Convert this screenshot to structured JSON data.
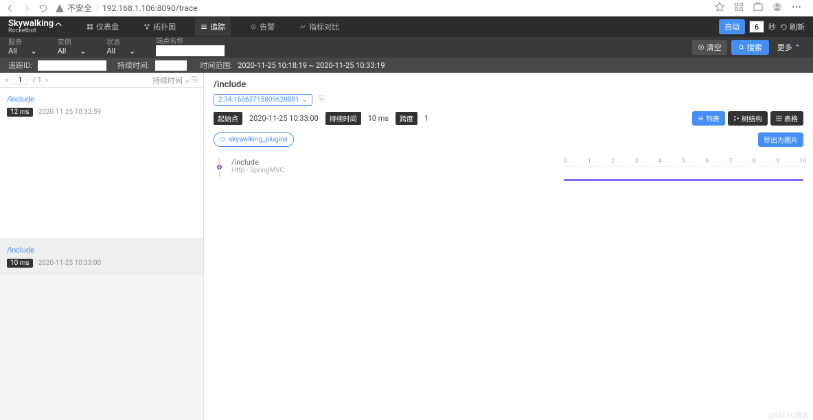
{
  "browser": {
    "insecure_label": "不安全",
    "url": "192.168.1.106:8090/trace"
  },
  "brand": {
    "top": "Skywalking",
    "bottom": "Rocketbot"
  },
  "nav": {
    "dashboard": "仪表盘",
    "topology": "拓扑图",
    "trace": "追踪",
    "alarm": "告警",
    "metrics_compare": "指标对比",
    "auto": "自动",
    "interval_value": "6",
    "interval_unit": "秒",
    "refresh": "刷新"
  },
  "filters": {
    "service_label": "服务",
    "service_value": "All",
    "instance_label": "实例",
    "instance_value": "All",
    "status_label": "状态",
    "status_value": "All",
    "endpoint_label": "端点名称",
    "clear": "清空",
    "search": "搜索",
    "more": "更多",
    "trace_id_label": "追踪ID:",
    "duration_label": "持续时间:",
    "time_range_label": "时间范围:",
    "time_range_value": "2020-11-25 10:18:19 ~ 2020-11-25 10:33:19"
  },
  "pager": {
    "page": "1",
    "total": "/ 1",
    "sort_label": "持续时间"
  },
  "traces": [
    {
      "name": "/include",
      "duration": "12 ms",
      "timestamp": "2020-11-25 10:32:59",
      "selected": false
    },
    {
      "name": "/include",
      "duration": "10 ms",
      "timestamp": "2020-11-25 10:33:00",
      "selected": true
    }
  ],
  "detail": {
    "title": "/include",
    "trace_id": "2.34.16062715809620001",
    "start_label": "起始点",
    "start_value": "2020-11-25 10:33:00",
    "duration_label": "持续时间",
    "duration_value": "10 ms",
    "span_label": "跨度",
    "span_value": "1",
    "plugin": "skywalking_plugins",
    "view_list": "列表",
    "view_tree": "树结构",
    "view_table": "表格",
    "export": "导出为图片",
    "span_name": "/include",
    "span_sub": "Http - SpringMVC",
    "axis_ticks": [
      "0",
      "1",
      "2",
      "3",
      "4",
      "5",
      "6",
      "7",
      "8",
      "9",
      "10"
    ]
  },
  "watermark": "@51CTO博客"
}
